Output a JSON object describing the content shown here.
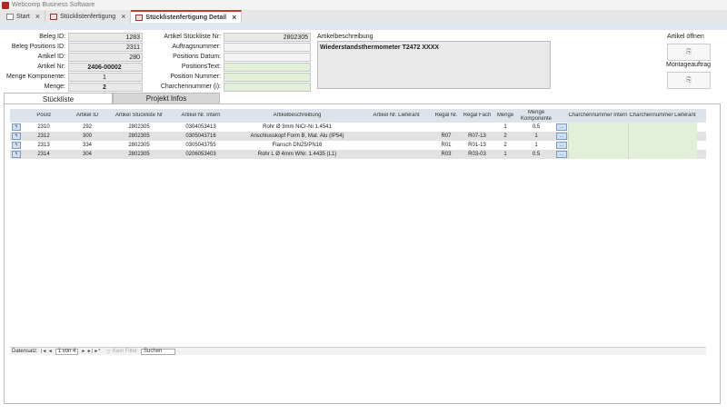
{
  "app": {
    "title": "Webcomp Business Software"
  },
  "tabs": [
    {
      "label": "Start"
    },
    {
      "label": "Stücklistenfertigung"
    },
    {
      "label": "Stücklistenfertigung Detail"
    }
  ],
  "close_glyph": "×",
  "header": {
    "beleg_id": {
      "label": "Beleg ID:",
      "value": "1283"
    },
    "beleg_positions_id": {
      "label": "Beleg Positions ID:",
      "value": "2311"
    },
    "artikel_id": {
      "label": "Artikel ID:",
      "value": "280"
    },
    "artikel_nr": {
      "label": "Artikel Nr:",
      "value": "2406-00002"
    },
    "menge_komponente": {
      "label": "Menge Komponente:",
      "value": "1"
    },
    "menge": {
      "label": "Menge:",
      "value": "2"
    },
    "artikel_stueckliste_nr": {
      "label": "Artikel Stückliste Nr:",
      "value": "2802305"
    },
    "auftragsnummer": {
      "label": "Auftragsnummer:",
      "value": ""
    },
    "positions_datum": {
      "label": "Positions Datum:",
      "value": ""
    },
    "positions_text": {
      "label": "PositionsText:",
      "value": ""
    },
    "position_nummer": {
      "label": "Position Nummer:",
      "value": ""
    },
    "charchennummer": {
      "label": "Charchennummer (i):",
      "value": ""
    },
    "artikelbeschreibung_label": "Artikelbeschreibung",
    "artikelbeschreibung": "Wiederstandsthermometer T2472 XXXX"
  },
  "side": {
    "artikel_oeffnen_label": "Artikel öffnen",
    "montageauftrag_label": "Montageauftrag"
  },
  "subtabs": [
    {
      "label": "Stückliste"
    },
    {
      "label": "Projekt Infos"
    }
  ],
  "grid": {
    "headers": [
      "PosId",
      "Artikel ID",
      "Artikel Stückliste Nr",
      "Artikel Nr. Intern",
      "Artikelbeschreibung",
      "Artikel Nr. Lieferant",
      "Regal Nr.",
      "Regal Fach",
      "Menge",
      "Menge Komponente",
      "Charchennummer Intern",
      "Charchennummer Lieferant"
    ],
    "rows": [
      {
        "posid": "2310",
        "artikel_id": "292",
        "stueckliste_nr": "2802305",
        "nr_intern": "0304053413",
        "beschreibung": "Rohr Ø 3mm NiCr-Ni 1.4541",
        "nr_lieferant": "",
        "regal_nr": "",
        "regal_fach": "",
        "menge": "1",
        "menge_komp": "0.5"
      },
      {
        "posid": "2312",
        "artikel_id": "300",
        "stueckliste_nr": "2802305",
        "nr_intern": "0305043716",
        "beschreibung": "Anschlusskopf Form B, Mat. Alu (IP54)",
        "nr_lieferant": "",
        "regal_nr": "R07",
        "regal_fach": "R07-13",
        "menge": "2",
        "menge_komp": "1"
      },
      {
        "posid": "2313",
        "artikel_id": "334",
        "stueckliste_nr": "2802305",
        "nr_intern": "0305043755",
        "beschreibung": "Flansch DN25/PN16",
        "nr_lieferant": "",
        "regal_nr": "R01",
        "regal_fach": "R01-13",
        "menge": "2",
        "menge_komp": "1"
      },
      {
        "posid": "2314",
        "artikel_id": "304",
        "stueckliste_nr": "2802305",
        "nr_intern": "0206053403",
        "beschreibung": "Rohr L Ø 4mm WNr. 1.4435 (L1)",
        "nr_lieferant": "",
        "regal_nr": "R03",
        "regal_fach": "R03-03",
        "menge": "1",
        "menge_komp": "0.5"
      }
    ]
  },
  "nav": {
    "label": "Datensatz:",
    "first": "|◄",
    "prev": "◄",
    "position": "1 von 4",
    "next": "►",
    "last": "►|",
    "new": "►*",
    "filter": "Kein Filter",
    "search_placeholder": "Suchen"
  },
  "icons": {
    "row_button": "↰",
    "mini_button": "…",
    "side_button": "⎘"
  },
  "colors": {
    "accent": "#c0392b",
    "field_green": "#e2f0d9",
    "header_strip": "#dfe7f1"
  }
}
